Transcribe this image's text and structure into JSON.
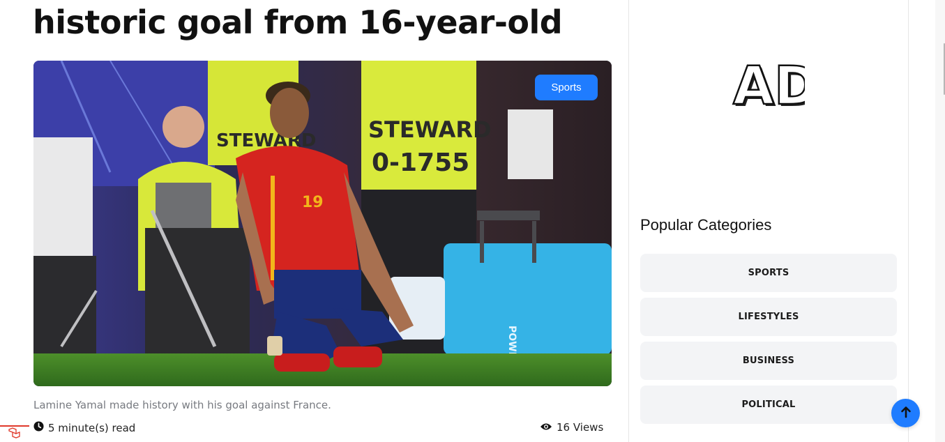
{
  "article": {
    "title": "historic goal from 16-year-old",
    "category_badge": "Sports",
    "caption": "Lamine Yamal made history with his goal against France.",
    "read_time": "5 minute(s) read",
    "views": "16 Views",
    "image_text": {
      "steward_left": "STEWARD",
      "steward_right_line1": "STEWARD",
      "steward_right_line2": "0-1755",
      "shirt_number": "19",
      "cooler_brand": "POWERADE"
    }
  },
  "sidebar": {
    "ad_label": "AD",
    "popular_heading": "Popular Categories",
    "categories": [
      {
        "label": "SPORTS"
      },
      {
        "label": "LIFESTYLES"
      },
      {
        "label": "BUSINESS"
      },
      {
        "label": "POLITICAL"
      }
    ]
  },
  "icons": {
    "clock": "clock-icon",
    "eye": "eye-icon",
    "back_to_top": "arrow-up-icon",
    "debug": "laravel-icon"
  },
  "colors": {
    "accent": "#1f7cff",
    "category_bg": "#f3f4f6",
    "caption": "#777a80"
  }
}
